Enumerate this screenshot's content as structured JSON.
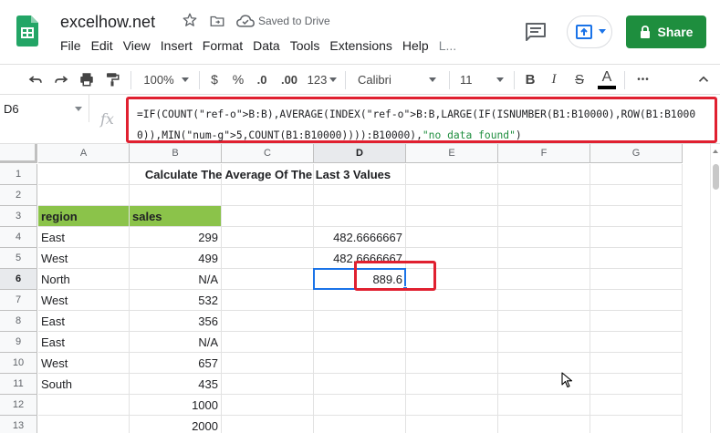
{
  "app": {
    "doc_title": "excelhow.net",
    "saved_status": "Saved to Drive",
    "share_label": "Share"
  },
  "menu": [
    "File",
    "Edit",
    "View",
    "Insert",
    "Format",
    "Data",
    "Tools",
    "Extensions",
    "Help",
    "L..."
  ],
  "toolbar": {
    "zoom": "100%",
    "currency": "$",
    "percent": "%",
    "decrease_decimal": ".0",
    "increase_decimal": ".00",
    "number_format": "123",
    "font": "Calibri",
    "font_size": "11",
    "bold": "B",
    "italic": "I",
    "strike": "S",
    "text_color": "A",
    "more": "•••"
  },
  "formula_bar": {
    "name_box": "D6",
    "fx": "fx",
    "formula": "=IF(COUNT(B:B),AVERAGE(INDEX(B:B,LARGE(IF(ISNUMBER(B1:B10000),ROW(B1:B10000)),MIN(5,COUNT(B1:B10000)))):B10000),\"no data found\")"
  },
  "sheet": {
    "columns": [
      "A",
      "B",
      "C",
      "D",
      "E",
      "F",
      "G"
    ],
    "rows": [
      "1",
      "2",
      "3",
      "4",
      "5",
      "6",
      "7",
      "8",
      "9",
      "10",
      "11",
      "12",
      "13"
    ],
    "title": "Calculate The Average Of The Last 3 Values",
    "header": {
      "region": "region",
      "sales": "sales"
    },
    "data": [
      {
        "region": "East",
        "sales": "299"
      },
      {
        "region": "West",
        "sales": "499"
      },
      {
        "region": "North",
        "sales": "N/A"
      },
      {
        "region": "West",
        "sales": "532"
      },
      {
        "region": "East",
        "sales": "356"
      },
      {
        "region": "East",
        "sales": "N/A"
      },
      {
        "region": "West",
        "sales": "657"
      },
      {
        "region": "South",
        "sales": "435"
      },
      {
        "region": "",
        "sales": "1000"
      },
      {
        "region": "",
        "sales": "2000"
      }
    ],
    "results": {
      "d4": "482.6666667",
      "d5": "482.6666667",
      "d6": "889.6"
    },
    "active_cell": "D6"
  },
  "colors": {
    "header_fill": "#8bc34a",
    "share_button": "#1e8e3e",
    "annotation_red": "#e02030",
    "selection_blue": "#1a73e8"
  }
}
